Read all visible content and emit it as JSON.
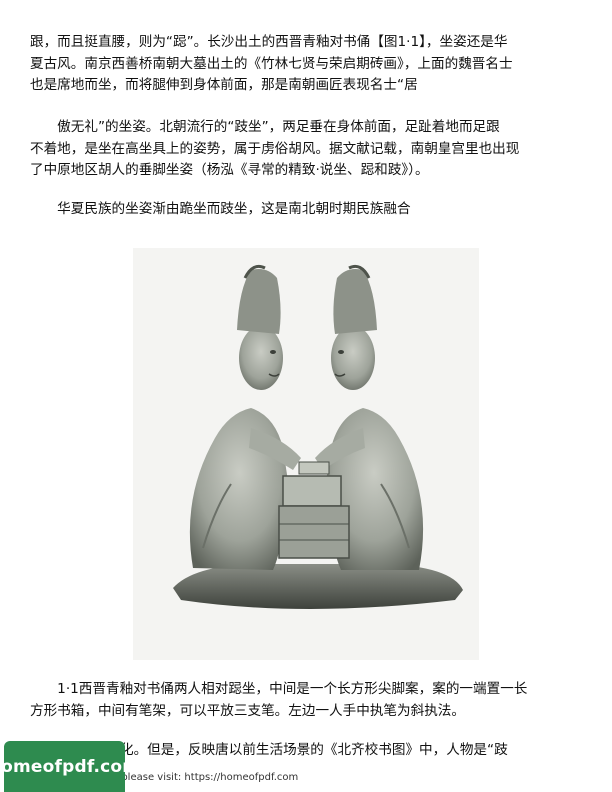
{
  "paragraphs": [
    {
      "lines": [
        "跟，而且挺直腰，则为“跽”。长沙出土的西晋青釉对书俑【图1·1】，坐姿还是华",
        "夏古风。南京西善桥南朝大墓出土的《竹林七贤与荣启期砖画》，上面的魏晋名士",
        "也是席地而坐，而将腿伸到身体前面，那是南朝画匠表现名士“居"
      ]
    },
    {
      "lines": [
        "　　傲无礼”的坐姿。北朝流行的“跂坐”，两足垂在身体前面，足趾着地而足跟",
        "不着地，是坐在高坐具上的姿势，属于虏俗胡风。据文献记载，南朝皇宫里也出现",
        "了中原地区胡人的垂脚坐姿（杨泓《寻常的精致·说坐、跽和跂》）。"
      ]
    },
    {
      "lines": [
        "　　华夏民族的坐姿渐由跪坐而跂坐，这是南北朝时期民族融合"
      ]
    },
    {
      "lines": [
        "　　1·1西晋青釉对书俑两人相对跽坐，中间是一个长方形尖脚案，案的一端置一长",
        "方形书箱，中间有笔架，可以平放三支笔。左边一人手中执笔为斜执法。"
      ]
    },
    {
      "lines": [
        "化。但是，反映唐以前生活场景的《北齐校书图》中，人物是“跂"
      ]
    }
  ],
  "footer": {
    "note": "e please visit: https://homeofpdf.com"
  },
  "brand": {
    "text": "homeofpdf.com",
    "color": "#2e8b4f"
  }
}
